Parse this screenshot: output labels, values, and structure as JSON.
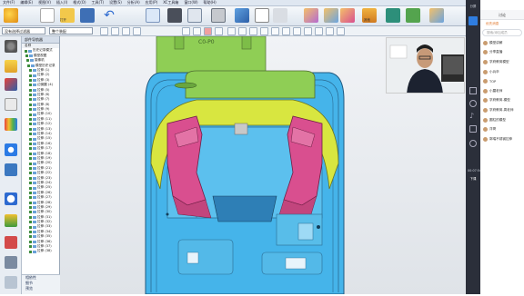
{
  "menubar": {
    "items": [
      "文件(F)",
      "编辑(E)",
      "视图(V)",
      "插入(I)",
      "格式(O)",
      "工具(T)",
      "设置(S)",
      "分析(A)",
      "应用(P)",
      "XC工具箱",
      "窗口(W)",
      "帮助(H)"
    ]
  },
  "ribbon": {
    "open_label": "打开",
    "other_label": "其他"
  },
  "toolbar": {
    "filter_value": "没有选择过滤器",
    "assembly_value": "整个装配"
  },
  "colors": {
    "yellow": "#d8e640",
    "blue": "#45b4ea",
    "pink": "#d94f8f",
    "green": "#8fce55"
  },
  "nav": {
    "title": "部件导航器",
    "tree_header": "名称",
    "items": [
      "历史记录模式",
      "模型视图",
      "摄像机",
      "模型历史记录",
      "拉伸 (1)",
      "拉伸 (2)",
      "拉伸 (3)",
      "边倒圆 (4)",
      "拉伸 (5)",
      "拉伸 (6)",
      "拉伸 (7)",
      "拉伸 (8)",
      "拉伸 (9)",
      "拉伸 (10)",
      "拉伸 (11)",
      "拉伸 (12)",
      "拉伸 (13)",
      "拉伸 (14)",
      "拉伸 (15)",
      "拉伸 (16)",
      "拉伸 (17)",
      "拉伸 (18)",
      "拉伸 (19)",
      "拉伸 (20)",
      "拉伸 (21)",
      "拉伸 (22)",
      "拉伸 (23)",
      "拉伸 (24)",
      "拉伸 (25)",
      "拉伸 (26)",
      "拉伸 (27)",
      "拉伸 (28)",
      "拉伸 (29)",
      "拉伸 (30)",
      "拉伸 (31)",
      "拉伸 (32)",
      "拉伸 (33)",
      "拉伸 (34)",
      "拉伸 (35)",
      "拉伸 (36)",
      "拉伸 (37)",
      "拉伸 (38)"
    ],
    "footer": [
      "相依性",
      "细节",
      "预览"
    ]
  },
  "viewport": {
    "stamp_text": "C0-P0"
  },
  "right": {
    "title": "讨论",
    "tab_hot": "优先消息",
    "search_placeholder": "搜索/添加成员",
    "dark_top_label": "分屏",
    "dark_bottom_label": "00:07:54",
    "dark_stop_label": "下课",
    "chats": [
      "模型讲解",
      "分享直播",
      "学府教育模型",
      "小兵卒",
      "TOP",
      "小蘑老师",
      "学府教育-模型",
      "学府教育-周老师",
      "圆柱的模型",
      "洋哥",
      "郭瑞不锈钢拉伸"
    ]
  }
}
